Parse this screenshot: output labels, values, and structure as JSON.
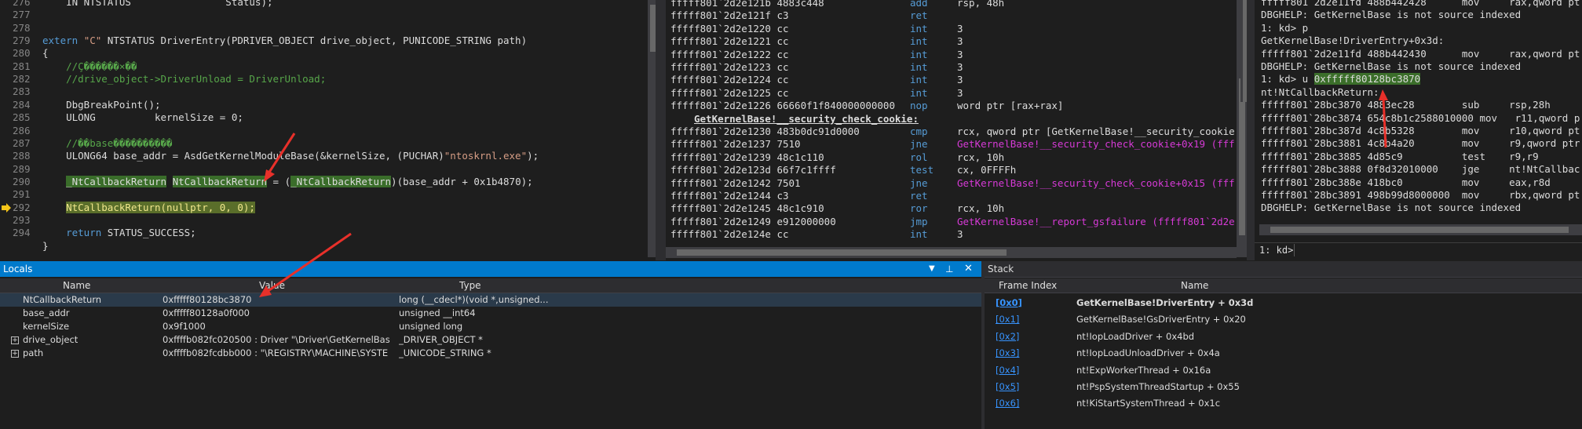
{
  "source": {
    "lines": [
      {
        "n": "276",
        "parts": [
          {
            "t": "    IN NTSTATUS                Status);",
            "c": "tx"
          }
        ]
      },
      {
        "n": "277",
        "parts": []
      },
      {
        "n": "278",
        "parts": []
      },
      {
        "n": "279",
        "parts": [
          {
            "t": "extern ",
            "c": "kw"
          },
          {
            "t": "\"C\"",
            "c": "st"
          },
          {
            "t": " NTSTATUS DriverEntry(PDRIVER_OBJECT drive_object, PUNICODE_STRING path)",
            "c": "tx"
          }
        ]
      },
      {
        "n": "280",
        "parts": [
          {
            "t": "{",
            "c": "tx"
          }
        ]
      },
      {
        "n": "281",
        "parts": [
          {
            "t": "    //Ç������×��",
            "c": "cm"
          }
        ]
      },
      {
        "n": "282",
        "parts": [
          {
            "t": "    //drive_object->DriverUnload = DriverUnload;",
            "c": "cm"
          }
        ]
      },
      {
        "n": "283",
        "parts": []
      },
      {
        "n": "284",
        "parts": [
          {
            "t": "    DbgBreakPoint();",
            "c": "tx"
          }
        ]
      },
      {
        "n": "285",
        "parts": [
          {
            "t": "    ULONG          kernelSize = 0;",
            "c": "tx"
          }
        ]
      },
      {
        "n": "286",
        "parts": []
      },
      {
        "n": "287",
        "parts": [
          {
            "t": "    //��base�������ַ���",
            "c": "cm"
          }
        ]
      },
      {
        "n": "288",
        "parts": [
          {
            "t": "    ULONG64 base_addr = AsdGetKernelModuleBase(&kernelSize, (PUCHAR)",
            "c": "tx"
          },
          {
            "t": "\"ntoskrnl.exe\"",
            "c": "st"
          },
          {
            "t": ");",
            "c": "tx"
          }
        ]
      },
      {
        "n": "289",
        "parts": []
      },
      {
        "n": "290",
        "parts": [
          {
            "t": "    ",
            "c": "tx"
          },
          {
            "t": "_NtCallbackReturn",
            "c": "hl"
          },
          {
            "t": " ",
            "c": "tx"
          },
          {
            "t": "NtCallbackReturn",
            "c": "hl"
          },
          {
            "t": " = (",
            "c": "tx"
          },
          {
            "t": "_NtCallbackReturn",
            "c": "hl"
          },
          {
            "t": ")(base_addr + 0x1b4870);",
            "c": "tx"
          }
        ]
      },
      {
        "n": "291",
        "parts": []
      },
      {
        "n": "292",
        "parts": [
          {
            "t": "    ",
            "c": "tx"
          },
          {
            "t": "NtCallbackReturn(nullptr, 0, 0);",
            "c": "hly"
          }
        ]
      },
      {
        "n": "293",
        "parts": []
      },
      {
        "n": "294",
        "parts": [
          {
            "t": "    ",
            "c": "tx"
          },
          {
            "t": "return",
            "c": "kw"
          },
          {
            "t": " STATUS_SUCCESS;",
            "c": "tx"
          }
        ]
      },
      {
        "n": "",
        "parts": [
          {
            "t": "}",
            "c": "tx"
          }
        ]
      }
    ]
  },
  "disasm": {
    "rows": [
      {
        "a": "fffff801`2d2e121b 4883c448",
        "m": "add",
        "o": [
          {
            "t": "rsp, 48h"
          }
        ]
      },
      {
        "a": "fffff801`2d2e121f c3",
        "m": "ret",
        "o": []
      },
      {
        "a": "fffff801`2d2e1220 cc",
        "m": "int",
        "o": [
          {
            "t": "3"
          }
        ]
      },
      {
        "a": "fffff801`2d2e1221 cc",
        "m": "int",
        "o": [
          {
            "t": "3"
          }
        ]
      },
      {
        "a": "fffff801`2d2e1222 cc",
        "m": "int",
        "o": [
          {
            "t": "3"
          }
        ]
      },
      {
        "a": "fffff801`2d2e1223 cc",
        "m": "int",
        "o": [
          {
            "t": "3"
          }
        ]
      },
      {
        "a": "fffff801`2d2e1224 cc",
        "m": "int",
        "o": [
          {
            "t": "3"
          }
        ]
      },
      {
        "a": "fffff801`2d2e1225 cc",
        "m": "int",
        "o": [
          {
            "t": "3"
          }
        ]
      },
      {
        "a": "fffff801`2d2e1226 66660f1f840000000000",
        "m": "nop",
        "o": [
          {
            "t": "word ptr [rax+rax]"
          }
        ]
      },
      {
        "sym": "GetKernelBase!__security_check_cookie:"
      },
      {
        "a": "fffff801`2d2e1230 483b0dc91d0000",
        "m": "cmp",
        "o": [
          {
            "t": "rcx, qword ptr [GetKernelBase!__security_cookie"
          }
        ]
      },
      {
        "a": "fffff801`2d2e1237 7510",
        "m": "jne",
        "o": [
          {
            "t": "GetKernelBase!__security_check_cookie+0x19 (fff",
            "c": "pink"
          }
        ]
      },
      {
        "a": "fffff801`2d2e1239 48c1c110",
        "m": "rol",
        "o": [
          {
            "t": "rcx, 10h"
          }
        ]
      },
      {
        "a": "fffff801`2d2e123d 66f7c1ffff",
        "m": "test",
        "o": [
          {
            "t": "cx, 0FFFFh"
          }
        ]
      },
      {
        "a": "fffff801`2d2e1242 7501",
        "m": "jne",
        "o": [
          {
            "t": "GetKernelBase!__security_check_cookie+0x15 (fff",
            "c": "pink"
          }
        ]
      },
      {
        "a": "fffff801`2d2e1244 c3",
        "m": "ret",
        "o": []
      },
      {
        "a": "fffff801`2d2e1245 48c1c910",
        "m": "ror",
        "o": [
          {
            "t": "rcx, 10h"
          }
        ]
      },
      {
        "a": "fffff801`2d2e1249 e912000000",
        "m": "jmp",
        "o": [
          {
            "t": "GetKernelBase!__report_gsfailure (fffff801`2d2e",
            "c": "pink"
          }
        ]
      },
      {
        "a": "fffff801`2d2e124e cc",
        "m": "int",
        "o": [
          {
            "t": "3"
          }
        ]
      }
    ]
  },
  "command": {
    "rows": [
      {
        "t": "fffff801`2d2e11fd 488b442428      mov     rax,qword pt"
      },
      {
        "t": "DBGHELP: GetKernelBase is not source indexed"
      },
      {
        "t": "1: kd> p"
      },
      {
        "t": "GetKernelBase!DriverEntry+0x3d:"
      },
      {
        "t": "fffff801`2d2e11fd 488b442430      mov     rax,qword pt"
      },
      {
        "t": "DBGHELP: GetKernelBase is not source indexed"
      },
      {
        "t": "1: kd> u ",
        "sel": "0xfffff80128bc3870"
      },
      {
        "t": "nt!NtCallbackReturn:"
      },
      {
        "t": "fffff801`28bc3870 4883ec28        sub     rsp,28h"
      },
      {
        "t": "fffff801`28bc3874 654c8b1c2588010000 mov   r11,qword p"
      },
      {
        "t": "fffff801`28bc387d 4c8b5328        mov     r10,qword pt"
      },
      {
        "t": "fffff801`28bc3881 4c8b4a20        mov     r9,qword ptr"
      },
      {
        "t": "fffff801`28bc3885 4d85c9          test    r9,r9"
      },
      {
        "t": "fffff801`28bc3888 0f8d32010000    jge     nt!NtCallbac"
      },
      {
        "t": "fffff801`28bc388e 418bc0          mov     eax,r8d"
      },
      {
        "t": "fffff801`28bc3891 498b99d8000000  mov     rbx,qword pt"
      },
      {
        "t": "DBGHELP: GetKernelBase is not source indexed"
      }
    ],
    "prompt": "1: kd>"
  },
  "locals": {
    "title": "Locals",
    "headers": {
      "name": "Name",
      "value": "Value",
      "type": "Type"
    },
    "rows": [
      {
        "name": "NtCallbackReturn",
        "value": "0xfffff80128bc3870",
        "type": "long (__cdecl*)(void *,unsigned...",
        "exp": false
      },
      {
        "name": "base_addr",
        "value": "0xfffff80128a0f000",
        "type": "unsigned __int64",
        "exp": false
      },
      {
        "name": "kernelSize",
        "value": "0x9f1000",
        "type": "unsigned long",
        "exp": false
      },
      {
        "name": "drive_object",
        "value": "0xffffb082fc020500 : Driver \"\\Driver\\GetKernelBase",
        "type": "_DRIVER_OBJECT *",
        "exp": true
      },
      {
        "name": "path",
        "value": "0xffffb082fcdbb000 : \"\\REGISTRY\\MACHINE\\SYSTE",
        "type": "_UNICODE_STRING *",
        "exp": true
      }
    ]
  },
  "stack": {
    "title": "Stack",
    "headers": {
      "index": "Frame Index",
      "name": "Name"
    },
    "rows": [
      {
        "i": "[0x0]",
        "n": "GetKernelBase!DriverEntry + 0x3d",
        "bold": true
      },
      {
        "i": "[0x1]",
        "n": "GetKernelBase!GsDriverEntry + 0x20"
      },
      {
        "i": "[0x2]",
        "n": "nt!IopLoadDriver + 0x4bd"
      },
      {
        "i": "[0x3]",
        "n": "nt!IopLoadUnloadDriver + 0x4a"
      },
      {
        "i": "[0x4]",
        "n": "nt!ExpWorkerThread + 0x16a"
      },
      {
        "i": "[0x5]",
        "n": "nt!PspSystemThreadStartup + 0x55"
      },
      {
        "i": "[0x6]",
        "n": "nt!KiStartSystemThread + 0x1c"
      }
    ]
  },
  "colors": {
    "accent": "#007acc",
    "annotation": "#e8302a",
    "selection": "#3b6e2a"
  }
}
